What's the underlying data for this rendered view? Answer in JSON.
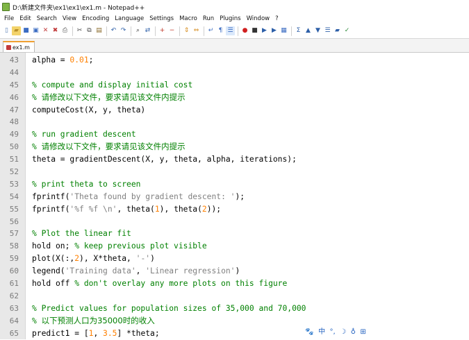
{
  "window": {
    "title": "D:\\新建文件夹\\ex1\\ex1\\ex1.m - Notepad++",
    "app_icon": "notepadpp-icon"
  },
  "menu": [
    "File",
    "Edit",
    "Search",
    "View",
    "Encoding",
    "Language",
    "Settings",
    "Macro",
    "Run",
    "Plugins",
    "Window",
    "?"
  ],
  "toolbar": {
    "buttons": [
      "new-file-icon",
      "open-file-icon",
      "save-icon",
      "save-all-icon",
      "close-icon",
      "close-all-icon",
      "print-icon",
      "sep",
      "cut-icon",
      "copy-icon",
      "paste-icon",
      "sep",
      "undo-icon",
      "redo-icon",
      "sep",
      "find-icon",
      "replace-icon",
      "sep",
      "zoom-in-icon",
      "zoom-out-icon",
      "sep",
      "sync-vertical-icon",
      "sync-horizontal-icon",
      "sep",
      "word-wrap-icon",
      "show-all-chars-icon",
      "indent-guide-icon",
      "sep",
      "record-macro-icon",
      "stop-record-icon",
      "play-macro-icon",
      "run-macro-multiple-icon",
      "save-macro-icon",
      "sep",
      "function-list-icon",
      "collapse-icon",
      "expand-icon",
      "document-map-icon",
      "folder-workspace-icon",
      "spell-check-icon"
    ]
  },
  "tab": {
    "label": "ex1.m"
  },
  "editor": {
    "lines": [
      {
        "n": "43",
        "tokens": [
          {
            "t": "alpha = ",
            "c": "plain"
          },
          {
            "t": "0.01",
            "c": "num"
          },
          {
            "t": ";",
            "c": "plain"
          }
        ]
      },
      {
        "n": "44",
        "tokens": []
      },
      {
        "n": "45",
        "tokens": [
          {
            "t": "% compute and display initial cost",
            "c": "com"
          }
        ]
      },
      {
        "n": "46",
        "tokens": [
          {
            "t": "% ",
            "c": "com"
          },
          {
            "t": "请修改以下文件，要求请见该文件内提示",
            "c": "com cjk"
          }
        ]
      },
      {
        "n": "47",
        "tokens": [
          {
            "t": "computeCost(X, y, theta)",
            "c": "plain"
          }
        ]
      },
      {
        "n": "48",
        "tokens": []
      },
      {
        "n": "49",
        "tokens": [
          {
            "t": "% run gradient descent",
            "c": "com"
          }
        ]
      },
      {
        "n": "50",
        "tokens": [
          {
            "t": "% ",
            "c": "com"
          },
          {
            "t": "请修改以下文件，要求请见该文件内提示",
            "c": "com cjk"
          }
        ]
      },
      {
        "n": "51",
        "tokens": [
          {
            "t": "theta = gradientDescent(X, y, theta, alpha, iterations);",
            "c": "plain"
          }
        ]
      },
      {
        "n": "52",
        "tokens": []
      },
      {
        "n": "53",
        "tokens": [
          {
            "t": "% print theta to screen",
            "c": "com"
          }
        ]
      },
      {
        "n": "54",
        "tokens": [
          {
            "t": "fprintf(",
            "c": "plain"
          },
          {
            "t": "'Theta found by gradient descent: '",
            "c": "str"
          },
          {
            "t": ");",
            "c": "plain"
          }
        ]
      },
      {
        "n": "55",
        "tokens": [
          {
            "t": "fprintf(",
            "c": "plain"
          },
          {
            "t": "'%f %f \\n'",
            "c": "str"
          },
          {
            "t": ", theta(",
            "c": "plain"
          },
          {
            "t": "1",
            "c": "num"
          },
          {
            "t": "), theta(",
            "c": "plain"
          },
          {
            "t": "2",
            "c": "num"
          },
          {
            "t": "));",
            "c": "plain"
          }
        ]
      },
      {
        "n": "56",
        "tokens": []
      },
      {
        "n": "57",
        "tokens": [
          {
            "t": "% Plot the linear fit",
            "c": "com"
          }
        ]
      },
      {
        "n": "58",
        "tokens": [
          {
            "t": "hold on; ",
            "c": "plain"
          },
          {
            "t": "% keep previous plot visible",
            "c": "com"
          }
        ]
      },
      {
        "n": "59",
        "tokens": [
          {
            "t": "plot(X(:,",
            "c": "plain"
          },
          {
            "t": "2",
            "c": "num"
          },
          {
            "t": "), X*theta, ",
            "c": "plain"
          },
          {
            "t": "'-'",
            "c": "str"
          },
          {
            "t": ")",
            "c": "plain"
          }
        ]
      },
      {
        "n": "60",
        "tokens": [
          {
            "t": "legend(",
            "c": "plain"
          },
          {
            "t": "'Training data'",
            "c": "str"
          },
          {
            "t": ", ",
            "c": "plain"
          },
          {
            "t": "'Linear regression'",
            "c": "str"
          },
          {
            "t": ")",
            "c": "plain"
          }
        ]
      },
      {
        "n": "61",
        "tokens": [
          {
            "t": "hold off ",
            "c": "plain"
          },
          {
            "t": "% don't overlay any more plots on this figure",
            "c": "com"
          }
        ]
      },
      {
        "n": "62",
        "tokens": []
      },
      {
        "n": "63",
        "tokens": [
          {
            "t": "% Predict values for population sizes of 35,000 and 70,000",
            "c": "com"
          }
        ]
      },
      {
        "n": "64",
        "tokens": [
          {
            "t": "% ",
            "c": "com"
          },
          {
            "t": "以下预测人口为35000时的收入",
            "c": "com cjk"
          }
        ]
      },
      {
        "n": "65",
        "tokens": [
          {
            "t": "predict1 = [",
            "c": "plain"
          },
          {
            "t": "1",
            "c": "num"
          },
          {
            "t": ", ",
            "c": "plain"
          },
          {
            "t": "3.5",
            "c": "num"
          },
          {
            "t": "] *theta;",
            "c": "plain"
          }
        ]
      }
    ]
  },
  "ime_bar": {
    "items": [
      {
        "icon": "paw-icon",
        "glyph": "🐾"
      },
      {
        "icon": "chinese-mode-icon",
        "glyph": "中"
      },
      {
        "icon": "punctuation-icon",
        "glyph": "°,"
      },
      {
        "icon": "halfwidth-moon-icon",
        "glyph": "☽"
      },
      {
        "icon": "soft-keyboard-icon",
        "glyph": "♁"
      },
      {
        "icon": "grid-menu-icon",
        "glyph": "⊞"
      }
    ]
  }
}
